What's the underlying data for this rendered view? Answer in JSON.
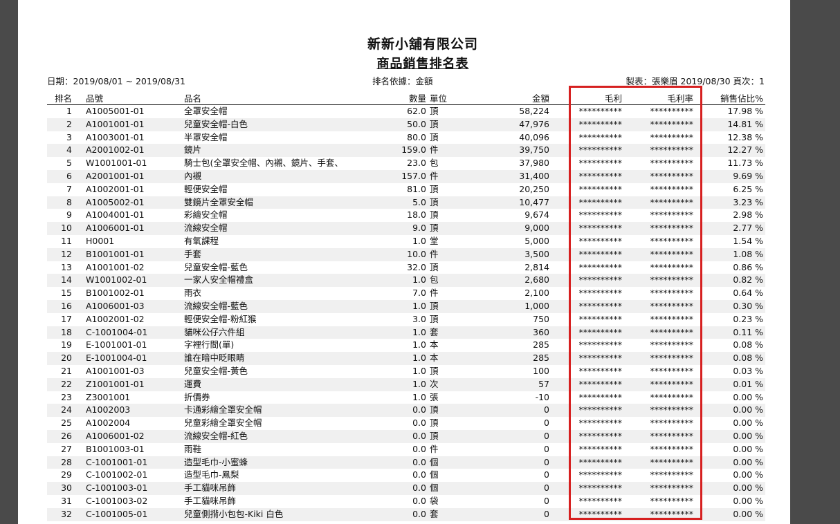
{
  "report": {
    "company": "新新小舖有限公司",
    "title": "商品銷售排名表",
    "date_range": "日期：2019/08/01 ~ 2019/08/31",
    "rank_basis": "排名依據：金額",
    "maker_info": "製表：張樂眉 2019/08/30 頁次：1"
  },
  "columns": {
    "rank": "排名",
    "code": "品號",
    "name": "品名",
    "qty": "數量",
    "unit": "單位",
    "amount": "金額",
    "gross_profit": "毛利",
    "gross_margin": "毛利率",
    "sales_pct": "銷售佔比%"
  },
  "rows": [
    {
      "rank": "1",
      "code": "A1005001-01",
      "name": "全罩安全帽",
      "qty": "62.0",
      "unit": "頂",
      "amount": "58,224",
      "gp": "**********",
      "gpr": "**********",
      "pct": "17.98 %"
    },
    {
      "rank": "2",
      "code": "A1001001-01",
      "name": "兒童安全帽-白色",
      "qty": "50.0",
      "unit": "頂",
      "amount": "47,976",
      "gp": "**********",
      "gpr": "**********",
      "pct": "14.81 %"
    },
    {
      "rank": "3",
      "code": "A1003001-01",
      "name": "半罩安全帽",
      "qty": "80.0",
      "unit": "頂",
      "amount": "40,096",
      "gp": "**********",
      "gpr": "**********",
      "pct": "12.38 %"
    },
    {
      "rank": "4",
      "code": "A2001002-01",
      "name": "鏡片",
      "qty": "159.0",
      "unit": "件",
      "amount": "39,750",
      "gp": "**********",
      "gpr": "**********",
      "pct": "12.27 %"
    },
    {
      "rank": "5",
      "code": "W1001001-01",
      "name": "騎士包(全罩安全帽、內襯、鏡片、手套、",
      "qty": "23.0",
      "unit": "包",
      "amount": "37,980",
      "gp": "**********",
      "gpr": "**********",
      "pct": "11.73 %"
    },
    {
      "rank": "6",
      "code": "A2001001-01",
      "name": "內襯",
      "qty": "157.0",
      "unit": "件",
      "amount": "31,400",
      "gp": "**********",
      "gpr": "**********",
      "pct": "9.69 %"
    },
    {
      "rank": "7",
      "code": "A1002001-01",
      "name": "輕便安全帽",
      "qty": "81.0",
      "unit": "頂",
      "amount": "20,250",
      "gp": "**********",
      "gpr": "**********",
      "pct": "6.25 %"
    },
    {
      "rank": "8",
      "code": "A1005002-01",
      "name": "雙鏡片全罩安全帽",
      "qty": "5.0",
      "unit": "頂",
      "amount": "10,477",
      "gp": "**********",
      "gpr": "**********",
      "pct": "3.23 %"
    },
    {
      "rank": "9",
      "code": "A1004001-01",
      "name": "彩繪安全帽",
      "qty": "18.0",
      "unit": "頂",
      "amount": "9,674",
      "gp": "**********",
      "gpr": "**********",
      "pct": "2.98 %"
    },
    {
      "rank": "10",
      "code": "A1006001-01",
      "name": "流線安全帽",
      "qty": "9.0",
      "unit": "頂",
      "amount": "9,000",
      "gp": "**********",
      "gpr": "**********",
      "pct": "2.77 %"
    },
    {
      "rank": "11",
      "code": "H0001",
      "name": "有氧課程",
      "qty": "1.0",
      "unit": "堂",
      "amount": "5,000",
      "gp": "**********",
      "gpr": "**********",
      "pct": "1.54 %"
    },
    {
      "rank": "12",
      "code": "B1001001-01",
      "name": "手套",
      "qty": "10.0",
      "unit": "件",
      "amount": "3,500",
      "gp": "**********",
      "gpr": "**********",
      "pct": "1.08 %"
    },
    {
      "rank": "13",
      "code": "A1001001-02",
      "name": "兒童安全帽-藍色",
      "qty": "32.0",
      "unit": "頂",
      "amount": "2,814",
      "gp": "**********",
      "gpr": "**********",
      "pct": "0.86 %"
    },
    {
      "rank": "14",
      "code": "W1001002-01",
      "name": "一家人安全帽禮盒",
      "qty": "1.0",
      "unit": "包",
      "amount": "2,680",
      "gp": "**********",
      "gpr": "**********",
      "pct": "0.82 %"
    },
    {
      "rank": "15",
      "code": "B1001002-01",
      "name": "雨衣",
      "qty": "7.0",
      "unit": "件",
      "amount": "2,100",
      "gp": "**********",
      "gpr": "**********",
      "pct": "0.64 %"
    },
    {
      "rank": "16",
      "code": "A1006001-03",
      "name": "流線安全帽-藍色",
      "qty": "1.0",
      "unit": "頂",
      "amount": "1,000",
      "gp": "**********",
      "gpr": "**********",
      "pct": "0.30 %"
    },
    {
      "rank": "17",
      "code": "A1002001-02",
      "name": "輕便安全帽-粉紅猴",
      "qty": "3.0",
      "unit": "頂",
      "amount": "750",
      "gp": "**********",
      "gpr": "**********",
      "pct": "0.23 %"
    },
    {
      "rank": "18",
      "code": "C-1001004-01",
      "name": "貓咪公仔六件組",
      "qty": "1.0",
      "unit": "套",
      "amount": "360",
      "gp": "**********",
      "gpr": "**********",
      "pct": "0.11 %"
    },
    {
      "rank": "19",
      "code": "E-1001001-01",
      "name": "字裡行間(單)",
      "qty": "1.0",
      "unit": "本",
      "amount": "285",
      "gp": "**********",
      "gpr": "**********",
      "pct": "0.08 %"
    },
    {
      "rank": "20",
      "code": "E-1001004-01",
      "name": "誰在暗中眨眼睛",
      "qty": "1.0",
      "unit": "本",
      "amount": "285",
      "gp": "**********",
      "gpr": "**********",
      "pct": "0.08 %"
    },
    {
      "rank": "21",
      "code": "A1001001-03",
      "name": "兒童安全帽-黃色",
      "qty": "1.0",
      "unit": "頂",
      "amount": "100",
      "gp": "**********",
      "gpr": "**********",
      "pct": "0.03 %"
    },
    {
      "rank": "22",
      "code": "Z1001001-01",
      "name": "運費",
      "qty": "1.0",
      "unit": "次",
      "amount": "57",
      "gp": "**********",
      "gpr": "**********",
      "pct": "0.01 %"
    },
    {
      "rank": "23",
      "code": "Z3001001",
      "name": "折價券",
      "qty": "1.0",
      "unit": "張",
      "amount": "-10",
      "gp": "**********",
      "gpr": "**********",
      "pct": "0.00 %"
    },
    {
      "rank": "24",
      "code": "A1002003",
      "name": "卡通彩繪全罩安全帽",
      "qty": "0.0",
      "unit": "頂",
      "amount": "0",
      "gp": "**********",
      "gpr": "**********",
      "pct": "0.00 %"
    },
    {
      "rank": "25",
      "code": "A1002004",
      "name": "兒童彩繪全罩安全帽",
      "qty": "0.0",
      "unit": "頂",
      "amount": "0",
      "gp": "**********",
      "gpr": "**********",
      "pct": "0.00 %"
    },
    {
      "rank": "26",
      "code": "A1006001-02",
      "name": "流線安全帽-紅色",
      "qty": "0.0",
      "unit": "頂",
      "amount": "0",
      "gp": "**********",
      "gpr": "**********",
      "pct": "0.00 %"
    },
    {
      "rank": "27",
      "code": "B1001003-01",
      "name": "雨鞋",
      "qty": "0.0",
      "unit": "件",
      "amount": "0",
      "gp": "**********",
      "gpr": "**********",
      "pct": "0.00 %"
    },
    {
      "rank": "28",
      "code": "C-1001001-01",
      "name": "造型毛巾-小蜜蜂",
      "qty": "0.0",
      "unit": "個",
      "amount": "0",
      "gp": "**********",
      "gpr": "**********",
      "pct": "0.00 %"
    },
    {
      "rank": "29",
      "code": "C-1001002-01",
      "name": "造型毛巾-鳳梨",
      "qty": "0.0",
      "unit": "個",
      "amount": "0",
      "gp": "**********",
      "gpr": "**********",
      "pct": "0.00 %"
    },
    {
      "rank": "30",
      "code": "C-1001003-01",
      "name": "手工貓咪吊飾",
      "qty": "0.0",
      "unit": "個",
      "amount": "0",
      "gp": "**********",
      "gpr": "**********",
      "pct": "0.00 %"
    },
    {
      "rank": "31",
      "code": "C-1001003-02",
      "name": "手工貓咪吊飾",
      "qty": "0.0",
      "unit": "袋",
      "amount": "0",
      "gp": "**********",
      "gpr": "**********",
      "pct": "0.00 %"
    },
    {
      "rank": "32",
      "code": "C-1001005-01",
      "name": "兒童側揹小包包-Kiki 白色",
      "qty": "0.0",
      "unit": "套",
      "amount": "0",
      "gp": "**********",
      "gpr": "**********",
      "pct": "0.00 %"
    }
  ],
  "colors": {
    "highlight_border": "#d62020",
    "row_stripe": "#f0f0f0",
    "viewer_bg": "#4a4a4a"
  }
}
